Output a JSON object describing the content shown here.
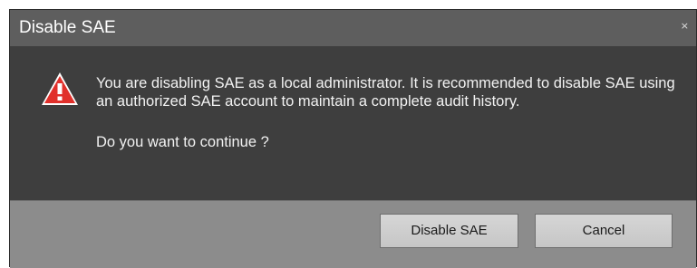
{
  "dialog": {
    "title": "Disable SAE",
    "close_glyph": "×",
    "icon": "warning-icon",
    "message": "You are disabling SAE as a local administrator. It is recommended to disable SAE using an authorized SAE account to maintain a complete audit history.",
    "question": "Do you want to continue ?",
    "buttons": {
      "confirm_label": "Disable SAE",
      "cancel_label": "Cancel"
    }
  },
  "colors": {
    "warning_red": "#e1302b",
    "body_bg": "#3e3e3e",
    "footer_bg": "#8c8c8c"
  }
}
